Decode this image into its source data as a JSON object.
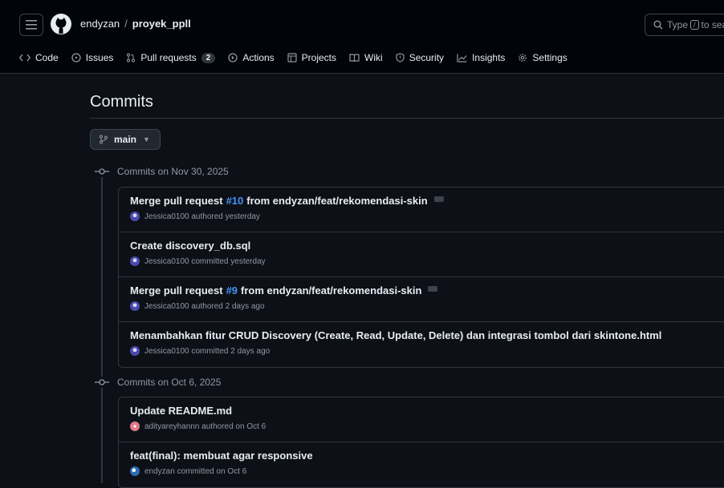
{
  "header": {
    "owner": "endyzan",
    "separator": "/",
    "repo": "proyek_ppll",
    "search_prefix": "Type",
    "search_key": "/",
    "search_suffix": "to sea"
  },
  "tabs": [
    {
      "label": "Code"
    },
    {
      "label": "Issues"
    },
    {
      "label": "Pull requests",
      "count": "2"
    },
    {
      "label": "Actions"
    },
    {
      "label": "Projects"
    },
    {
      "label": "Wiki"
    },
    {
      "label": "Security"
    },
    {
      "label": "Insights"
    },
    {
      "label": "Settings"
    }
  ],
  "page_title": "Commits",
  "branch": "main",
  "groups": [
    {
      "heading": "Commits on Nov 30, 2025",
      "commits": [
        {
          "pre": "Merge pull request",
          "link": "#10",
          "post": "from endyzan/feat/rekomendasi-skin",
          "meta": "Jessica0100 authored yesterday"
        },
        {
          "pre": "Create discovery_db.sql",
          "link": "",
          "post": "",
          "meta": "Jessica0100 committed yesterday"
        },
        {
          "pre": "Merge pull request",
          "link": "#9",
          "post": "from endyzan/feat/rekomendasi-skin",
          "meta": "Jessica0100 authored 2 days ago"
        },
        {
          "pre": "Menambahkan fitur CRUD Discovery (Create, Read, Update, Delete) dan integrasi tombol dari skintone.html",
          "link": "",
          "post": "",
          "meta": "Jessica0100 committed 2 days ago"
        }
      ]
    },
    {
      "heading": "Commits on Oct 6, 2025",
      "commits": [
        {
          "pre": "Update README.md",
          "link": "",
          "post": "",
          "meta": "adityareyhannn authored on Oct 6"
        },
        {
          "pre": "feat(final): membuat agar responsive",
          "link": "",
          "post": "",
          "meta": "endyzan committed on Oct 6"
        }
      ]
    }
  ],
  "colors": {
    "accent_link": "#4493f8",
    "background": "#0d1117"
  }
}
